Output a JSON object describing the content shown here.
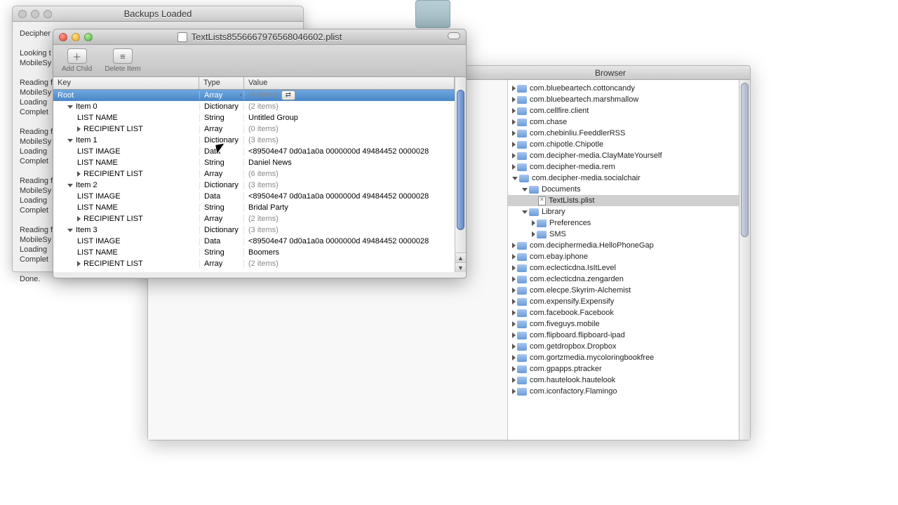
{
  "folder_bg": {},
  "backups": {
    "title": "Backups Loaded",
    "lines": [
      "Decipher",
      "",
      "Looking t",
      "MobileSy",
      "",
      "Reading f",
      "MobileSy",
      "Loading",
      "Complet",
      "",
      "Reading f",
      "MobileSy",
      "Loading",
      "Complet",
      "",
      "Reading f",
      "MobileSy",
      "Loading",
      "Complet",
      "",
      "Reading f",
      "MobileSy",
      "Loading",
      "Complet",
      "",
      "Done."
    ]
  },
  "plist": {
    "title": "TextLists8556667976568046602.plist",
    "toolbar": {
      "add": "Add Child",
      "delete": "Delete Item"
    },
    "columns": {
      "key": "Key",
      "type": "Type",
      "value": "Value"
    },
    "rows": [
      {
        "indent": 0,
        "tri": "",
        "key": "Root",
        "type": "Array",
        "value": "(4 items)",
        "sel": true,
        "dim": true,
        "typeSel": true,
        "angle": true
      },
      {
        "indent": 1,
        "tri": "down",
        "key": "Item 0",
        "type": "Dictionary",
        "value": "(2 items)",
        "dim": true
      },
      {
        "indent": 2,
        "tri": "",
        "key": "LIST NAME",
        "type": "String",
        "value": "Untitled Group"
      },
      {
        "indent": 2,
        "tri": "right",
        "key": "RECIPIENT LIST",
        "type": "Array",
        "value": "(0 items)",
        "dim": true
      },
      {
        "indent": 1,
        "tri": "down",
        "key": "Item 1",
        "type": "Dictionary",
        "value": "(3 items)",
        "dim": true
      },
      {
        "indent": 2,
        "tri": "",
        "key": "LIST IMAGE",
        "type": "Data",
        "value": "<89504e47 0d0a1a0a 0000000d 49484452 0000028"
      },
      {
        "indent": 2,
        "tri": "",
        "key": "LIST NAME",
        "type": "String",
        "value": "Daniel News"
      },
      {
        "indent": 2,
        "tri": "right",
        "key": "RECIPIENT LIST",
        "type": "Array",
        "value": "(6 items)",
        "dim": true
      },
      {
        "indent": 1,
        "tri": "down",
        "key": "Item 2",
        "type": "Dictionary",
        "value": "(3 items)",
        "dim": true
      },
      {
        "indent": 2,
        "tri": "",
        "key": "LIST IMAGE",
        "type": "Data",
        "value": "<89504e47 0d0a1a0a 0000000d 49484452 0000028"
      },
      {
        "indent": 2,
        "tri": "",
        "key": "LIST NAME",
        "type": "String",
        "value": "Bridal Party"
      },
      {
        "indent": 2,
        "tri": "right",
        "key": "RECIPIENT LIST",
        "type": "Array",
        "value": "(2 items)",
        "dim": true
      },
      {
        "indent": 1,
        "tri": "down",
        "key": "Item 3",
        "type": "Dictionary",
        "value": "(3 items)",
        "dim": true
      },
      {
        "indent": 2,
        "tri": "",
        "key": "LIST IMAGE",
        "type": "Data",
        "value": "<89504e47 0d0a1a0a 0000000d 49484452 0000028"
      },
      {
        "indent": 2,
        "tri": "",
        "key": "LIST NAME",
        "type": "String",
        "value": "Boomers"
      },
      {
        "indent": 2,
        "tri": "right",
        "key": "RECIPIENT LIST",
        "type": "Array",
        "value": "(2 items)",
        "dim": true
      }
    ]
  },
  "browser": {
    "title": "Browser",
    "items": [
      {
        "i": 0,
        "t": "right",
        "f": "folder",
        "n": "com.bluebeartech.cottoncandy"
      },
      {
        "i": 0,
        "t": "right",
        "f": "folder",
        "n": "com.bluebeartech.marshmallow"
      },
      {
        "i": 0,
        "t": "right",
        "f": "folder",
        "n": "com.cellfire.client"
      },
      {
        "i": 0,
        "t": "right",
        "f": "folder",
        "n": "com.chase"
      },
      {
        "i": 0,
        "t": "right",
        "f": "folder",
        "n": "com.chebinliu.FeeddlerRSS"
      },
      {
        "i": 0,
        "t": "right",
        "f": "folder",
        "n": "com.chipotle.Chipotle"
      },
      {
        "i": 0,
        "t": "right",
        "f": "folder",
        "n": "com.decipher-media.ClayMateYourself"
      },
      {
        "i": 0,
        "t": "right",
        "f": "folder",
        "n": "com.decipher-media.rem"
      },
      {
        "i": 0,
        "t": "down",
        "f": "folder",
        "n": "com.decipher-media.socialchair"
      },
      {
        "i": 1,
        "t": "down",
        "f": "folder",
        "n": "Documents"
      },
      {
        "i": 2,
        "t": "",
        "f": "file",
        "n": "TextLists.plist",
        "sel": true
      },
      {
        "i": 1,
        "t": "down",
        "f": "folder",
        "n": "Library"
      },
      {
        "i": 2,
        "t": "right",
        "f": "folder",
        "n": "Preferences"
      },
      {
        "i": 2,
        "t": "right",
        "f": "folder",
        "n": "SMS"
      },
      {
        "i": 0,
        "t": "right",
        "f": "folder",
        "n": "com.deciphermedia.HelloPhoneGap"
      },
      {
        "i": 0,
        "t": "right",
        "f": "folder",
        "n": "com.ebay.iphone"
      },
      {
        "i": 0,
        "t": "right",
        "f": "folder",
        "n": "com.eclecticdna.IsItLevel"
      },
      {
        "i": 0,
        "t": "right",
        "f": "folder",
        "n": "com.eclecticdna.zengarden"
      },
      {
        "i": 0,
        "t": "right",
        "f": "folder",
        "n": "com.elecpe.Skyrim-Alchemist"
      },
      {
        "i": 0,
        "t": "right",
        "f": "folder",
        "n": "com.expensify.Expensify"
      },
      {
        "i": 0,
        "t": "right",
        "f": "folder",
        "n": "com.facebook.Facebook"
      },
      {
        "i": 0,
        "t": "right",
        "f": "folder",
        "n": "com.fiveguys.mobile"
      },
      {
        "i": 0,
        "t": "right",
        "f": "folder",
        "n": "com.flipboard.flipboard-ipad"
      },
      {
        "i": 0,
        "t": "right",
        "f": "folder",
        "n": "com.getdropbox.Dropbox"
      },
      {
        "i": 0,
        "t": "right",
        "f": "folder",
        "n": "com.gortzmedia.mycoloringbookfree"
      },
      {
        "i": 0,
        "t": "right",
        "f": "folder",
        "n": "com.gpapps.ptracker"
      },
      {
        "i": 0,
        "t": "right",
        "f": "folder",
        "n": "com.hautelook.hautelook"
      },
      {
        "i": 0,
        "t": "right",
        "f": "folder",
        "n": "com.iconfactory.Flamingo"
      }
    ]
  }
}
